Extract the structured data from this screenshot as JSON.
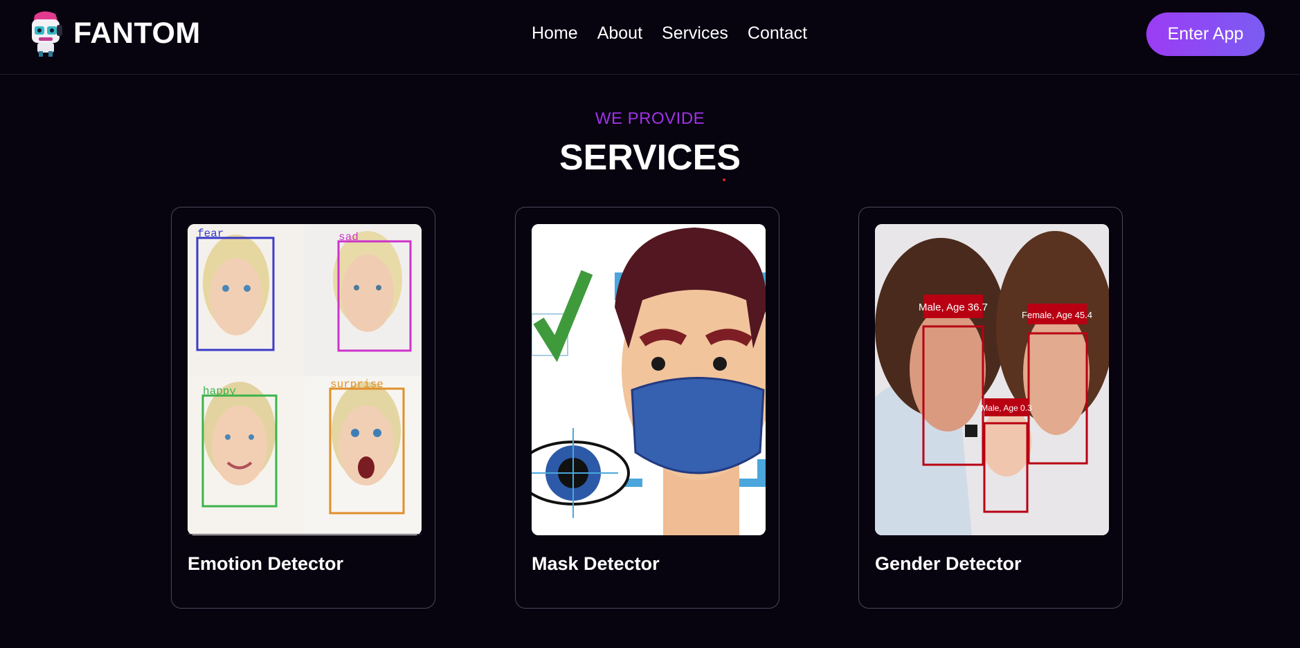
{
  "brand": {
    "name": "FANTOM",
    "logo_icon": "robot-mascot-icon"
  },
  "nav": {
    "items": [
      {
        "label": "Home"
      },
      {
        "label": "About"
      },
      {
        "label": "Services"
      },
      {
        "label": "Contact"
      }
    ],
    "cta_label": "Enter App"
  },
  "section": {
    "eyebrow": "WE PROVIDE",
    "title": "SERVICES"
  },
  "cards": [
    {
      "title": "Emotion Detector",
      "image_labels": [
        "fear",
        "sad",
        "happy",
        "surprise"
      ]
    },
    {
      "title": "Mask Detector"
    },
    {
      "title": "Gender Detector",
      "image_labels": [
        "Male, Age 36.7",
        "Female, Age 45.4",
        "Male, Age 0.3"
      ]
    }
  ],
  "colors": {
    "background": "#07030f",
    "accent": "#a033e8",
    "button_gradient_start": "#9b3cf5",
    "button_gradient_end": "#7b5cf2",
    "card_border": "#4a4a5c"
  }
}
